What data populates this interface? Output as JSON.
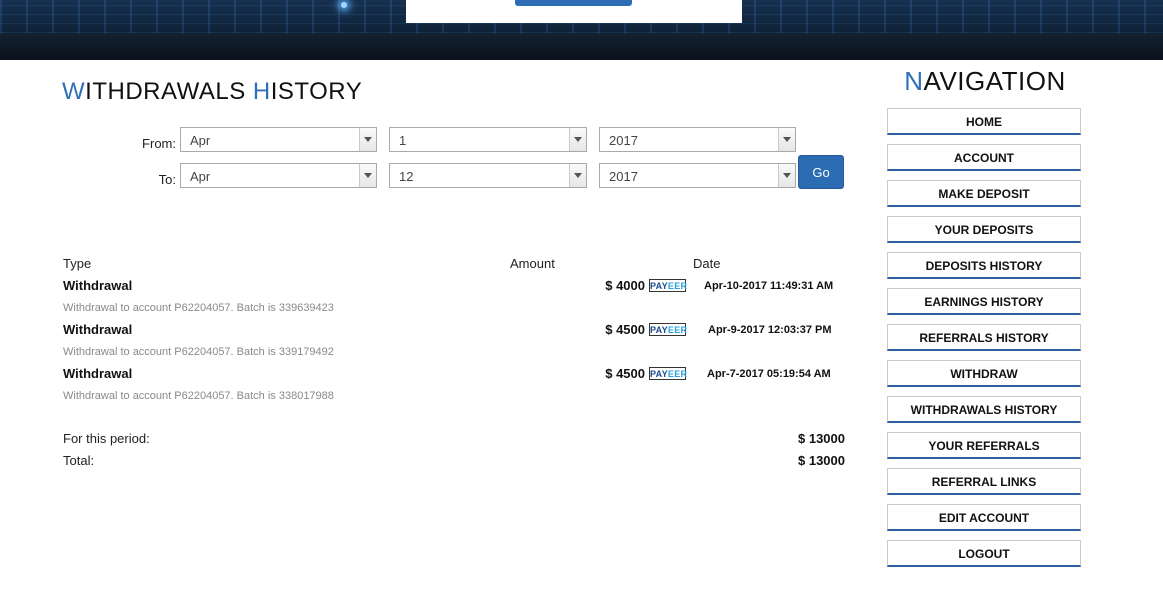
{
  "header": {
    "title_cap1": "W",
    "title_rest1": "ITHDRAWALS ",
    "title_cap2": "H",
    "title_rest2": "ISTORY"
  },
  "filter": {
    "from_label": "From:",
    "to_label": "To:",
    "from_month": "Apr",
    "from_day": "1",
    "from_year": "2017",
    "to_month": "Apr",
    "to_day": "12",
    "to_year": "2017",
    "go_label": "Go"
  },
  "table": {
    "headers": {
      "type": "Type",
      "amount": "Amount",
      "date": "Date"
    },
    "rows": [
      {
        "type": "Withdrawal",
        "amount": "$ 4000",
        "processor": "PAYEER",
        "date": "Apr-10-2017 11:49:31 AM",
        "desc": "Withdrawal to account P62204057. Batch is 339639423"
      },
      {
        "type": "Withdrawal",
        "amount": "$ 4500",
        "processor": "PAYEER",
        "date": "Apr-9-2017 12:03:37 PM",
        "desc": "Withdrawal to account P62204057. Batch is 339179492"
      },
      {
        "type": "Withdrawal",
        "amount": "$ 4500",
        "processor": "PAYEER",
        "date": "Apr-7-2017 05:19:54 AM",
        "desc": "Withdrawal to account P62204057. Batch is 338017988"
      }
    ]
  },
  "summary": {
    "period_label": "For this period:",
    "period_value": "$ 13000",
    "total_label": "Total:",
    "total_value": "$ 13000"
  },
  "navigation": {
    "title_cap": "N",
    "title_rest": "AVIGATION",
    "items": [
      "HOME",
      "ACCOUNT",
      "MAKE DEPOSIT",
      "YOUR DEPOSITS",
      "DEPOSITS HISTORY",
      "EARNINGS HISTORY",
      "REFERRALS HISTORY",
      "WITHDRAW",
      "WITHDRAWALS HISTORY",
      "YOUR REFERRALS",
      "REFERRAL LINKS",
      "EDIT ACCOUNT",
      "LOGOUT"
    ]
  },
  "colors": {
    "accent": "#2f6fb7",
    "button": "#2b6cb3",
    "banner": "#0c1420"
  }
}
